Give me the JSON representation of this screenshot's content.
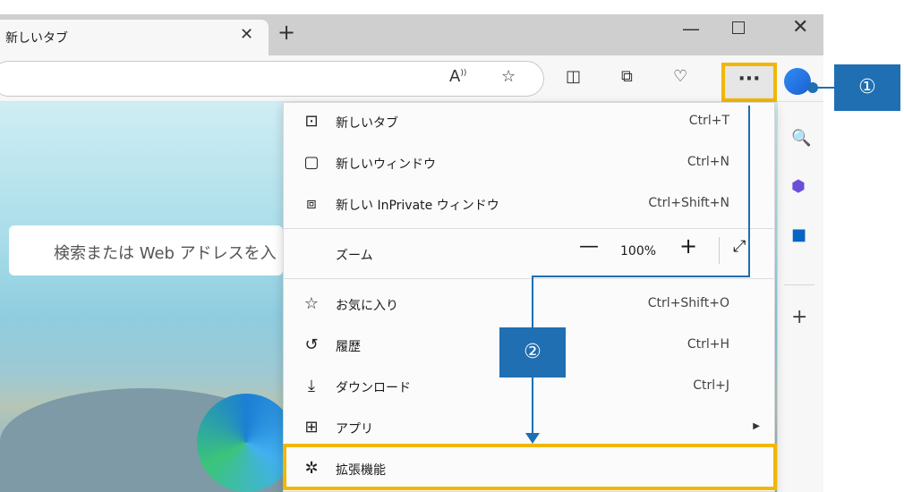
{
  "tab": {
    "title": "新しいタブ"
  },
  "search": {
    "placeholder": "検索または Web アドレスを入"
  },
  "menu": {
    "items": [
      {
        "icon": "new-tab-icon",
        "label": "新しいタブ",
        "shortcut": "Ctrl+T"
      },
      {
        "icon": "new-window-icon",
        "label": "新しいウィンドウ",
        "shortcut": "Ctrl+N"
      },
      {
        "icon": "inprivate-icon",
        "label": "新しい InPrivate ウィンドウ",
        "shortcut": "Ctrl+Shift+N"
      },
      {
        "icon": "favorites-icon",
        "label": "お気に入り",
        "shortcut": "Ctrl+Shift+O"
      },
      {
        "icon": "history-icon",
        "label": "履歴",
        "shortcut": "Ctrl+H"
      },
      {
        "icon": "download-icon",
        "label": "ダウンロード",
        "shortcut": "Ctrl+J"
      },
      {
        "icon": "apps-icon",
        "label": "アプリ",
        "shortcut": ""
      },
      {
        "icon": "extensions-icon",
        "label": "拡張機能",
        "shortcut": ""
      }
    ],
    "zoom": {
      "label": "ズーム",
      "value": "100%"
    }
  },
  "callouts": {
    "one": "①",
    "two": "②"
  },
  "colors": {
    "highlight": "#f2b705",
    "callout": "#1f6fb2"
  }
}
